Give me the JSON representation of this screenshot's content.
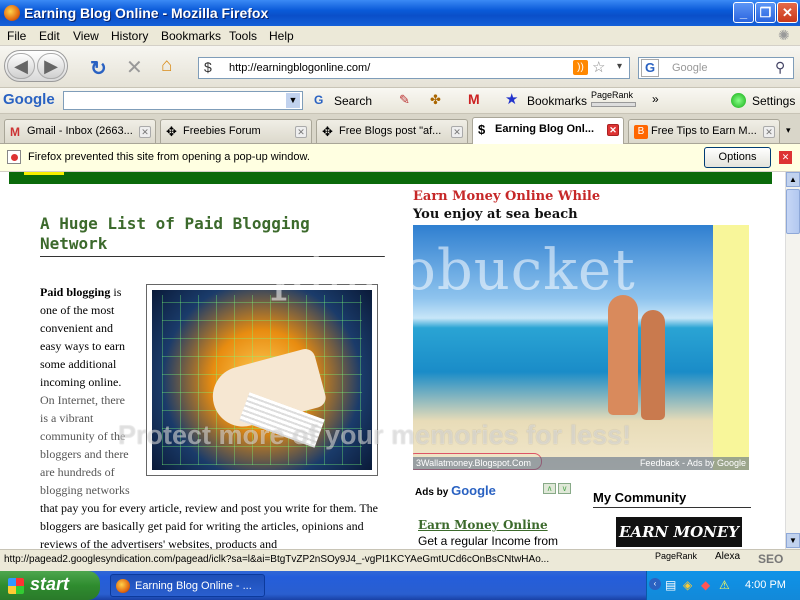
{
  "window": {
    "title": "Earning Blog Online - Mozilla Firefox",
    "buttons": [
      "_",
      "❐",
      "✕"
    ]
  },
  "menu": [
    "File",
    "Edit",
    "View",
    "History",
    "Bookmarks",
    "Tools",
    "Help"
  ],
  "nav": {
    "url": "http://earningblogonline.com/",
    "search_placeholder": "Google"
  },
  "google_toolbar": {
    "logo": "Google",
    "search_label": "Search",
    "bookmarks_label": "Bookmarks",
    "pagerank_label": "PageRank",
    "settings_label": "Settings",
    "more": "»"
  },
  "tabs": [
    {
      "label": "Gmail - Inbox (2663...",
      "color": "#c33"
    },
    {
      "label": "Freebies Forum",
      "color": "#222"
    },
    {
      "label": "Free Blogs post \"af...",
      "color": "#222"
    },
    {
      "label": "Earning Blog Onl...",
      "color": "#556"
    },
    {
      "label": "Free Tips to Earn M...",
      "color": "#f60"
    }
  ],
  "popup": {
    "message": "Firefox prevented this site from opening a pop-up window.",
    "options_label": "Options"
  },
  "page": {
    "post_title": "A Huge List of Paid Blogging Network",
    "intro_bold": "Paid blogging",
    "intro_rest": "is one of the most convenient and easy ways to earn some additional incoming online.",
    "para2": "On Internet, there is a vibrant community of the bloggers and there are hundreds of blogging networks",
    "para3": "that pay you for every article, review and post you write for them. The bloggers are basically get paid for writing the articles, opinions and reviews of the advertisers' websites, products and",
    "ad_title_red": "Earn Money Online While",
    "ad_title_black": "You enjoy at sea beach",
    "ad_url": "3Wallatmoney.Blogspot.Com",
    "ad_feedback": "Feedback - Ads by Google",
    "adsby": "Ads by Google",
    "adsby_logo": "Google",
    "link_title": "Earn Money Online",
    "link_text": "Get a regular Income from",
    "community": "My Community",
    "earn_banner": "EARN MONEY",
    "watermark_main": "photobucket",
    "watermark_sub": "Protect more of your memories for less!"
  },
  "status": {
    "text": "http://pagead2.googlesyndication.com/pagead/iclk?sa=l&ai=BtgTvZP2nSOy9J4_-vgPI1KCYAeGmtUCd6cOnBsCNtwHAo...",
    "pagerank": "PageRank",
    "alexa": "Alexa",
    "seo": "SEO"
  },
  "taskbar": {
    "start": "start",
    "task": "Earning Blog Online - ...",
    "clock": "4:00 PM"
  }
}
